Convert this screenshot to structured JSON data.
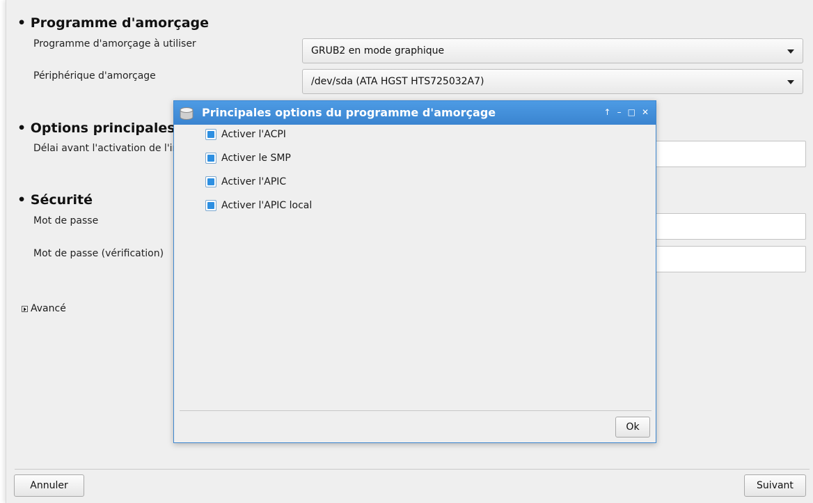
{
  "bootloader": {
    "section_title": "• Programme d'amorçage",
    "loader_label": "Programme d'amorçage à utiliser",
    "loader_value": "GRUB2 en mode graphique",
    "device_label": "Périphérique d'amorçage",
    "device_value": "/dev/sda (ATA HGST HTS725032A7)"
  },
  "main_options": {
    "section_title": "• Options principales",
    "delay_label": "Délai avant l'activation de l'image par défaut"
  },
  "security": {
    "section_title": "• Sécurité",
    "password_label": "Mot de passe",
    "password_check_label": "Mot de passe (vérification)"
  },
  "advanced": {
    "label": "Avancé"
  },
  "footer": {
    "cancel_label": "Annuler",
    "next_label": "Suivant"
  },
  "dialog": {
    "title": "Principales options du programme d'amorçage",
    "options": [
      {
        "label": "Activer l'ACPI",
        "checked": true
      },
      {
        "label": "Activer le SMP",
        "checked": true
      },
      {
        "label": "Activer l'APIC",
        "checked": true
      },
      {
        "label": "Activer l'APIC local",
        "checked": true
      }
    ],
    "ok_label": "Ok"
  }
}
